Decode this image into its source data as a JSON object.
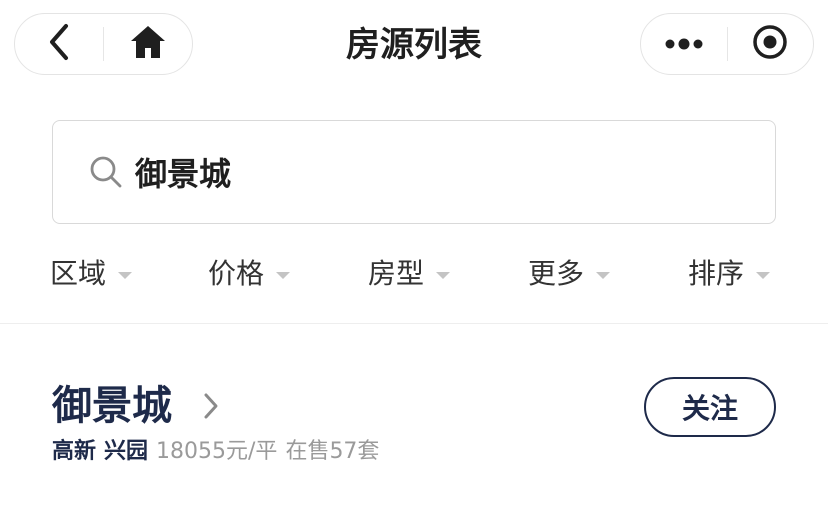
{
  "nav": {
    "title": "房源列表",
    "left_buttons": [
      {
        "icon": "back-icon"
      },
      {
        "icon": "home-icon"
      }
    ],
    "right_buttons": [
      {
        "icon": "more-icon"
      },
      {
        "icon": "record-icon"
      }
    ]
  },
  "search": {
    "icon": "search-icon",
    "value": "御景城",
    "placeholder": ""
  },
  "filters": [
    {
      "label": "区域"
    },
    {
      "label": "价格"
    },
    {
      "label": "房型"
    },
    {
      "label": "更多"
    },
    {
      "label": "排序"
    }
  ],
  "listing": {
    "title": "御景城",
    "district": "高新",
    "area": "兴园",
    "price": "18055元/平",
    "on_sale": "在售57套",
    "follow_label": "关注"
  },
  "colors": {
    "primary_text": "#1e2a4a",
    "secondary_text": "#9a9a9a",
    "border": "#d9d9d9"
  }
}
